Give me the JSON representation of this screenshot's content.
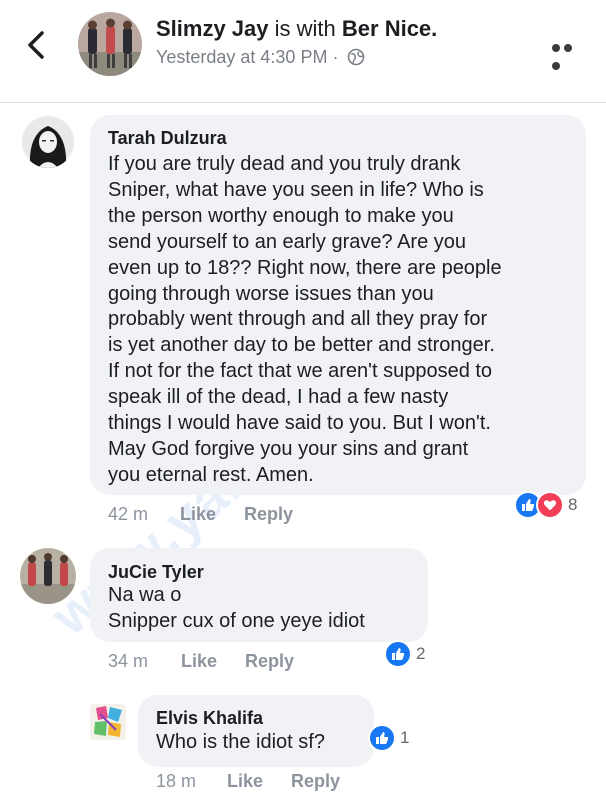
{
  "header": {
    "author": "Slimzy Jay",
    "with_text": "is with",
    "tagged": "Ber Nice.",
    "time": "Yesterday at 4:30 PM",
    "separator": "·",
    "back_icon": "chevron-left-icon",
    "privacy_icon": "globe-icon",
    "more_icon": "more-options-icon"
  },
  "comments": [
    {
      "author": "Tarah Dulzura",
      "lines": [
        "If you are truly dead and you truly drank",
        "Sniper, what have you seen in life? Who is",
        "the person worthy enough to make you",
        "send yourself to an early grave? Are you",
        "even up to 18?? Right now, there are people",
        "going through worse issues than you",
        "probably went through and all they pray for",
        "is yet another day to be better and stronger.",
        "If not for the fact that we aren't supposed to",
        "speak ill of the dead, I had a few nasty",
        "things I would have said to you. But I won't.",
        "May God forgive you your sins and grant",
        "you eternal rest. Amen."
      ],
      "time": "42 m",
      "like": "Like",
      "reply": "Reply",
      "reaction_count": "8",
      "reactions": [
        "like",
        "love"
      ]
    },
    {
      "author": "JuCie Tyler",
      "lines": [
        "Na wa o",
        "Snipper cux of one yeye idiot"
      ],
      "time": "34 m",
      "like": "Like",
      "reply": "Reply",
      "reaction_count": "2",
      "reactions": [
        "like"
      ]
    },
    {
      "author": "Elvis Khalifa",
      "lines": [
        "Who is the idiot sf?"
      ],
      "time": "18 m",
      "like": "Like",
      "reply": "Reply",
      "reaction_count": "1",
      "reactions": [
        "like"
      ]
    }
  ],
  "watermark": "www.yabaleftonline.com",
  "colors": {
    "like_blue": "#1877f2",
    "love_red": "#f33e58",
    "bubble": "#f0f2f5",
    "meta_gray": "#8d949e"
  }
}
